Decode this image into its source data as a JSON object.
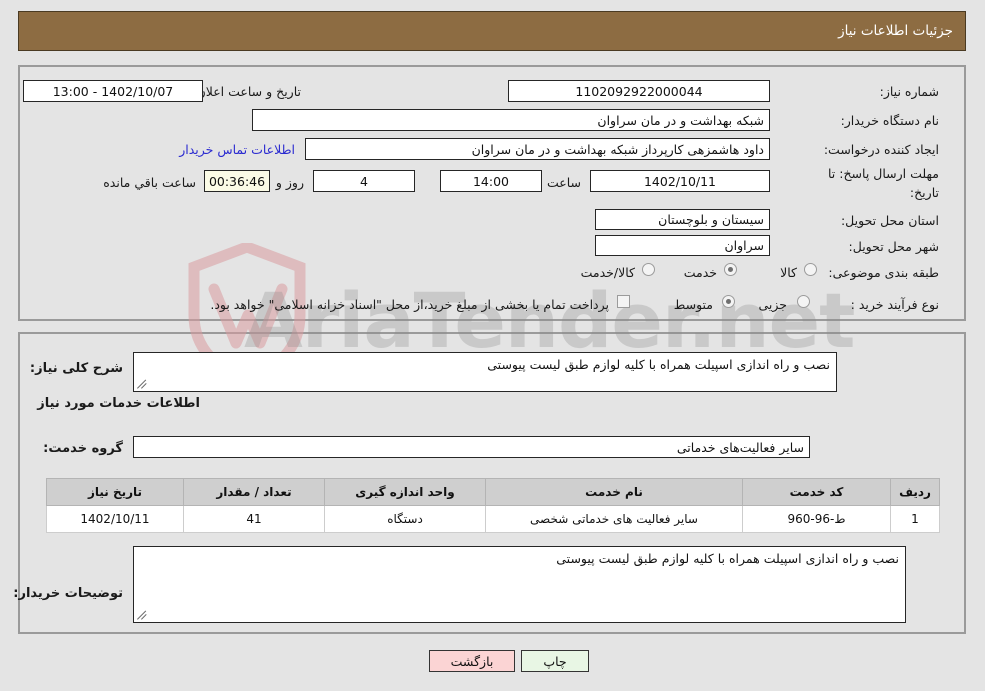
{
  "header": {
    "title": "جزئیات اطلاعات نیاز"
  },
  "top_section": {
    "need_number": {
      "label": "شماره نیاز:",
      "value": "1102092922000044"
    },
    "announce_datetime": {
      "label": "تاریخ و ساعت اعلان عمومی:",
      "value": "13:00 - 1402/10/07"
    },
    "buyer_org": {
      "label": "نام دستگاه خریدار:",
      "value": "شبکه بهداشت و در مان سراوان"
    },
    "creator": {
      "label": "ایجاد کننده درخواست:",
      "value": "داود هاشمزهی  کارپرداز شبکه بهداشت و در مان سراوان"
    },
    "contact_link": "اطلاعات تماس خریدار",
    "deadline": {
      "label": "مهلت ارسال پاسخ: تا تاریخ:",
      "date": "1402/10/11",
      "hour_label": "ساعت",
      "hour": "14:00",
      "days": "4",
      "days_unit": "روز و",
      "timer": "00:36:46",
      "timer_unit": "ساعت باقي مانده"
    },
    "province": {
      "label": "استان محل تحویل:",
      "value": "سیستان و بلوچستان"
    },
    "city": {
      "label": "شهر محل تحویل:",
      "value": "سراوان"
    },
    "category": {
      "label": "طبقه بندی موضوعی:",
      "options": [
        "کالا",
        "خدمت",
        "کالا/خدمت"
      ],
      "selected": "خدمت"
    },
    "purchase_type": {
      "label": "نوع فرآیند خرید :",
      "options": [
        "جزیی",
        "متوسط"
      ],
      "selected": "متوسط",
      "checkbox_label": "پرداخت تمام یا بخشی از مبلغ خرید،از محل \"اسناد خزانه اسلامی\" خواهد بود.",
      "checkbox_checked": false
    }
  },
  "mid_section": {
    "need_summary": {
      "label": "شرح کلی نیاز:",
      "value": "نصب و راه اندازی اسپیلت همراه با کلیه لوازم طبق لیست پیوستی"
    },
    "services_heading": "اطلاعات خدمات مورد نیاز",
    "service_group": {
      "label": "گروه خدمت:",
      "value": "سایر فعالیت‌های خدماتی"
    },
    "table": {
      "columns": [
        "ردیف",
        "کد خدمت",
        "نام خدمت",
        "واحد اندازه گیری",
        "تعداد / مقدار",
        "تاریخ نیاز"
      ],
      "rows": [
        {
          "row_no": "1",
          "service_code": "ط-96-960",
          "service_name": "سایر فعالیت های خدماتی شخصی",
          "unit": "دستگاه",
          "quantity": "41",
          "need_date": "1402/10/11"
        }
      ]
    },
    "buyer_notes": {
      "label": "توضیحات خریدار:",
      "value": "نصب و راه اندازی اسپیلت همراه با کلیه لوازم طبق لیست پیوستی"
    }
  },
  "footer": {
    "back_button": "بازگشت",
    "print_button": "چاپ"
  },
  "watermark": {
    "text": "AriaTender.net",
    "shield_color": "#d89a9f"
  }
}
